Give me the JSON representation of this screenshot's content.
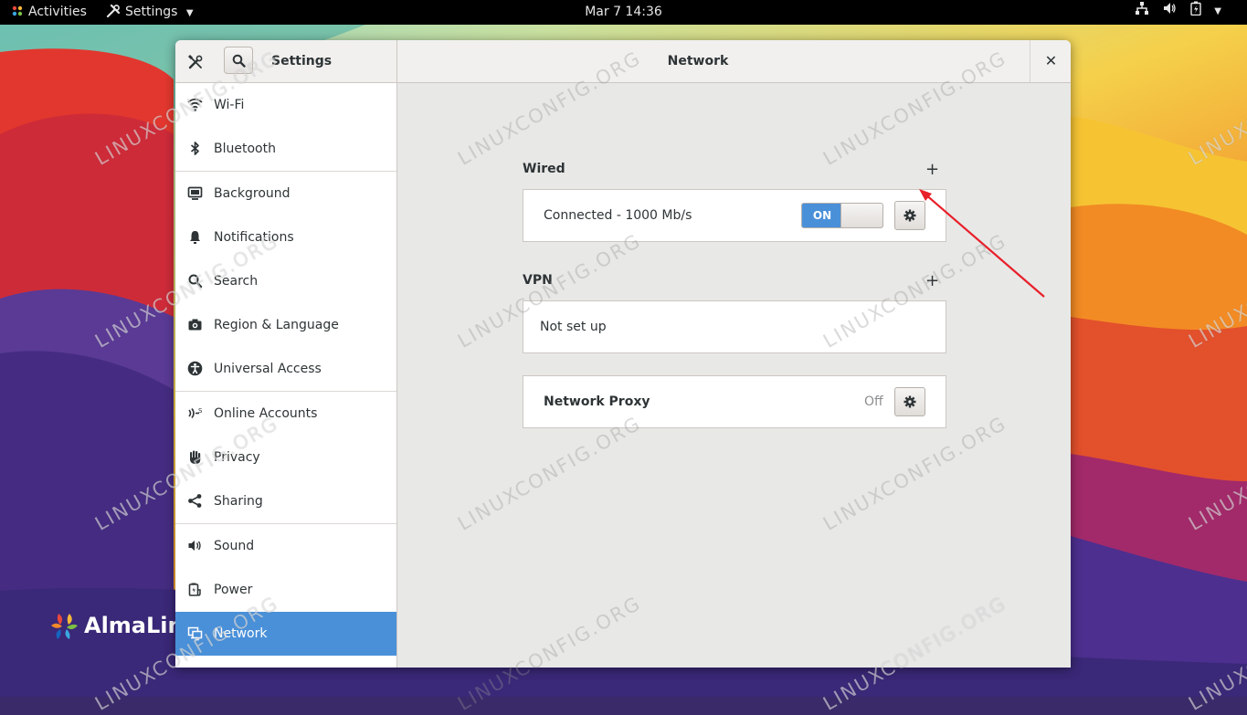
{
  "topbar": {
    "activities": "Activities",
    "app_menu": "Settings",
    "clock": "Mar 7  14:36"
  },
  "window": {
    "sidebar_title": "Settings",
    "title": "Network",
    "close_glyph": "✕"
  },
  "sidebar": {
    "items": [
      {
        "label": "Wi-Fi",
        "icon": "wifi-icon"
      },
      {
        "label": "Bluetooth",
        "icon": "bluetooth-icon"
      },
      {
        "label": "Background",
        "icon": "background-icon"
      },
      {
        "label": "Notifications",
        "icon": "bell-icon"
      },
      {
        "label": "Search",
        "icon": "search-icon"
      },
      {
        "label": "Region & Language",
        "icon": "camera-icon"
      },
      {
        "label": "Universal Access",
        "icon": "accessibility-icon"
      },
      {
        "label": "Online Accounts",
        "icon": "online-accounts-icon"
      },
      {
        "label": "Privacy",
        "icon": "hand-icon"
      },
      {
        "label": "Sharing",
        "icon": "share-icon"
      },
      {
        "label": "Sound",
        "icon": "speaker-icon"
      },
      {
        "label": "Power",
        "icon": "power-icon"
      },
      {
        "label": "Network",
        "icon": "network-icon",
        "active": true
      }
    ]
  },
  "network": {
    "wired": {
      "title": "Wired",
      "add": "+",
      "status": "Connected - 1000 Mb/s",
      "switch_label": "ON",
      "enabled": true
    },
    "vpn": {
      "title": "VPN",
      "add": "+",
      "status": "Not set up"
    },
    "proxy": {
      "label": "Network Proxy",
      "state": "Off"
    }
  },
  "desktop": {
    "logo_text": "AlmaLin",
    "watermark": "LINUXCONFIG.ORG"
  },
  "colors": {
    "accent": "#4a90d9",
    "annotation_arrow": "#e8202a"
  }
}
